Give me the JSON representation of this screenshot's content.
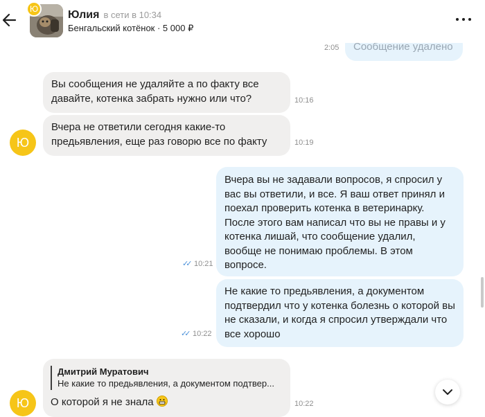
{
  "header": {
    "avatar_badge": "Ю",
    "name": "Юлия",
    "status": "в сети в 10:34",
    "subtitle": "Бенгальский котёнок · 5 000 ₽"
  },
  "messages": {
    "m1": {
      "text": "Сообщение удалено",
      "time": "2:05"
    },
    "m2": {
      "text": "Вы сообщения не удаляйте а по факту все давайте, котенка забрать нужно или что?",
      "time": "10:16"
    },
    "m3": {
      "text": "Вчера не ответили сегодня какие-то предьявления, еще раз говорю все по факту",
      "time": "10:19"
    },
    "m4": {
      "text": "Вчера вы не задавали вопросов, я спросил у вас вы ответили, и все. Я ваш ответ принял и поехал проверить котенка в ветеринарку. После этого вам написал что вы не правы и у котенка лишай, что сообщение удалил, вообще не понимаю проблемы. В этом вопросе.",
      "time": "10:21"
    },
    "m5": {
      "text": "Не какие то предьявления, а документом подтвердил что у котенка болезнь о которой вы не сказали, и когда я спросил утверждали что все хорошо",
      "time": "10:22"
    },
    "m6": {
      "quote_author": "Дмитрий Муратович",
      "quote_text": "Не какие то предьявления, а документом подтвер...",
      "text": "О которой я не знала",
      "time": "10:22"
    }
  },
  "incoming_avatar_letter": "Ю",
  "colors": {
    "accent_yellow": "#f6c518",
    "incoming_bubble": "#f0efee",
    "outgoing_bubble": "#e6f3fc",
    "read_ticks": "#4a90d9"
  },
  "icons": [
    "back-arrow-icon",
    "more-options-icon",
    "double-check-icon",
    "chevron-down-icon",
    "grinning-emoji-icon"
  ]
}
